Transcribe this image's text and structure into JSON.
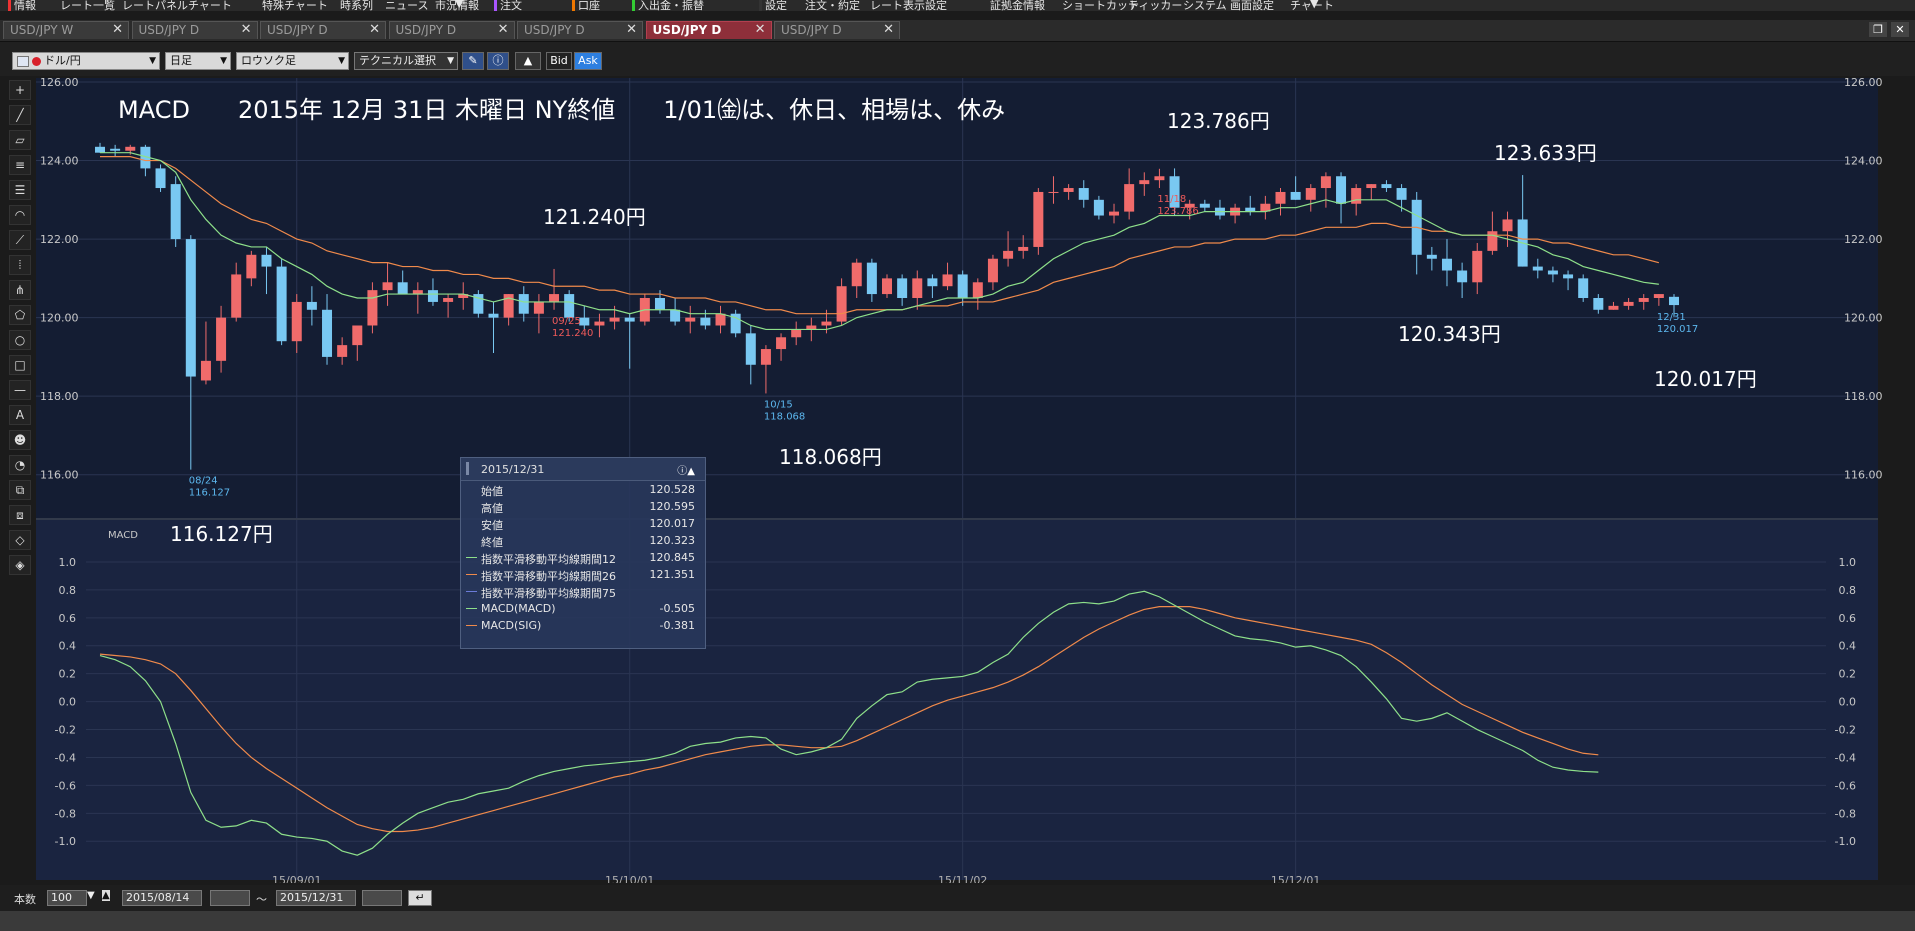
{
  "menu": [
    "情報",
    "レート一覧",
    "レートパネル",
    "チャート",
    "特殊チャート",
    "時系列",
    "ニュース",
    "市況情報",
    "▼",
    "注文",
    "口座",
    "入出金・振替",
    "設定",
    "注文・約定",
    "レート表示設定",
    "証拠金情報",
    "ショートカット",
    "ティッカー",
    "システム",
    "画面設定",
    "チャート",
    "▼"
  ],
  "tabs": [
    {
      "label": "USD/JPY W"
    },
    {
      "label": "USD/JPY D"
    },
    {
      "label": "USD/JPY D"
    },
    {
      "label": "USD/JPY D"
    },
    {
      "label": "USD/JPY D"
    },
    {
      "label": "USD/JPY D",
      "active": true
    },
    {
      "label": "USD/JPY D"
    }
  ],
  "toolbar": {
    "pair": "ドル/円",
    "period": "日足",
    "chart_type": "ロウソク足",
    "technical": "テクニカル選択",
    "bid": "Bid",
    "ask": "Ask"
  },
  "tools": [
    "crosshair-icon",
    "line-icon",
    "ruler-icon",
    "lines-icon",
    "channel-icon",
    "arc-icon",
    "fan-icon",
    "grid-icon",
    "pitchfork-icon",
    "pentagon-icon",
    "circle-icon",
    "rectangle-icon",
    "hline-icon",
    "text-icon",
    "smiley-icon",
    "paint-icon",
    "copy-icon",
    "layers-icon",
    "eraser-icon",
    "eraser-all-icon"
  ],
  "tool_text": {
    "text": "A",
    "smiley": "☻"
  },
  "annotation": {
    "headline": "MACD　　2015年 12月 31日 木曜日 NY終値　　1/01㈮は、休日、相場は、休み",
    "p1": "121.240円",
    "p2": "123.786円",
    "p3": "123.633円",
    "p4": "120.343円",
    "p5": "120.017円",
    "p6": "118.068円",
    "p7": "116.127円"
  },
  "chart_data": {
    "type": "candlestick",
    "price_ticks": [
      "126.00",
      "124.00",
      "122.00",
      "120.00",
      "118.00",
      "116.00"
    ],
    "macd_ticks": [
      "1.0",
      "0.8",
      "0.6",
      "0.4",
      "0.2",
      "0.0",
      "-0.2",
      "-0.4",
      "-0.6",
      "-0.8",
      "-1.0"
    ],
    "x_ticks": [
      "15/09/01",
      "15/10/01",
      "15/11/02",
      "15/12/01"
    ],
    "macd_label": "MACD",
    "ylim": [
      115.0,
      126.0
    ],
    "macd_ylim": [
      -1.12,
      1.1
    ],
    "marks": [
      {
        "date": "08/24",
        "value": "116.127",
        "color": "#5cb7ee"
      },
      {
        "date": "09/25",
        "value": "121.240",
        "color": "#ef5a5a"
      },
      {
        "date": "10/15",
        "value": "118.068",
        "color": "#5cb7ee"
      },
      {
        "date": "11/18",
        "value": "123.786",
        "color": "#ef5a5a"
      },
      {
        "date": "12/31",
        "value": "120.017",
        "color": "#5cb7ee"
      }
    ],
    "candles": [
      [
        124.35,
        124.45,
        124.2,
        124.2
      ],
      [
        124.3,
        124.4,
        124.1,
        124.25
      ],
      [
        124.25,
        124.4,
        124.15,
        124.35
      ],
      [
        124.35,
        124.4,
        123.6,
        123.8
      ],
      [
        123.8,
        123.9,
        123.2,
        123.3
      ],
      [
        123.4,
        123.6,
        121.8,
        122.0
      ],
      [
        122.0,
        122.1,
        116.13,
        118.5
      ],
      [
        118.4,
        119.9,
        118.3,
        118.9
      ],
      [
        118.9,
        120.3,
        118.6,
        120.0
      ],
      [
        120.0,
        121.4,
        119.9,
        121.1
      ],
      [
        121.0,
        121.7,
        120.8,
        121.6
      ],
      [
        121.6,
        121.8,
        120.6,
        121.3
      ],
      [
        121.3,
        121.5,
        119.3,
        119.4
      ],
      [
        119.4,
        120.6,
        119.1,
        120.4
      ],
      [
        120.4,
        120.8,
        119.8,
        120.2
      ],
      [
        120.2,
        120.6,
        118.8,
        119.0
      ],
      [
        119.0,
        119.5,
        118.8,
        119.3
      ],
      [
        119.3,
        119.8,
        118.9,
        119.8
      ],
      [
        119.8,
        120.9,
        119.6,
        120.7
      ],
      [
        120.7,
        121.4,
        120.3,
        120.9
      ],
      [
        120.9,
        121.2,
        120.6,
        120.6
      ],
      [
        120.6,
        120.9,
        120.1,
        120.7
      ],
      [
        120.7,
        121.0,
        120.3,
        120.4
      ],
      [
        120.4,
        120.6,
        120.0,
        120.5
      ],
      [
        120.5,
        120.9,
        120.2,
        120.6
      ],
      [
        120.6,
        120.7,
        120.0,
        120.1
      ],
      [
        120.1,
        120.4,
        119.1,
        120.0
      ],
      [
        120.0,
        120.6,
        119.8,
        120.6
      ],
      [
        120.6,
        120.8,
        119.9,
        120.1
      ],
      [
        120.1,
        120.6,
        119.6,
        120.4
      ],
      [
        120.4,
        121.24,
        120.2,
        120.6
      ],
      [
        120.6,
        120.7,
        119.9,
        120.0
      ],
      [
        120.0,
        120.3,
        119.7,
        119.8
      ],
      [
        119.8,
        120.1,
        119.5,
        119.9
      ],
      [
        119.9,
        120.3,
        119.7,
        120.0
      ],
      [
        120.0,
        120.1,
        118.7,
        119.9
      ],
      [
        119.9,
        120.6,
        119.8,
        120.5
      ],
      [
        120.5,
        120.7,
        120.1,
        120.2
      ],
      [
        120.2,
        120.5,
        119.8,
        119.9
      ],
      [
        119.9,
        120.3,
        119.6,
        120.0
      ],
      [
        120.0,
        120.2,
        119.7,
        119.8
      ],
      [
        119.8,
        120.3,
        119.6,
        120.1
      ],
      [
        120.1,
        120.2,
        119.5,
        119.6
      ],
      [
        119.6,
        119.8,
        118.3,
        118.8
      ],
      [
        118.8,
        119.3,
        118.07,
        119.2
      ],
      [
        119.2,
        119.6,
        118.9,
        119.5
      ],
      [
        119.5,
        119.9,
        119.3,
        119.7
      ],
      [
        119.7,
        120.0,
        119.4,
        119.8
      ],
      [
        119.8,
        120.2,
        119.6,
        119.9
      ],
      [
        119.9,
        121.0,
        119.8,
        120.8
      ],
      [
        120.8,
        121.5,
        120.5,
        121.4
      ],
      [
        121.4,
        121.5,
        120.4,
        120.6
      ],
      [
        120.6,
        121.1,
        120.5,
        121.0
      ],
      [
        121.0,
        121.1,
        120.3,
        120.5
      ],
      [
        120.5,
        121.2,
        120.2,
        121.0
      ],
      [
        121.0,
        121.1,
        120.5,
        120.8
      ],
      [
        120.8,
        121.4,
        120.7,
        121.1
      ],
      [
        121.1,
        121.2,
        120.3,
        120.5
      ],
      [
        120.5,
        121.0,
        120.2,
        120.9
      ],
      [
        120.9,
        121.6,
        120.7,
        121.5
      ],
      [
        121.5,
        122.2,
        121.3,
        121.7
      ],
      [
        121.7,
        122.1,
        121.5,
        121.8
      ],
      [
        121.8,
        123.3,
        121.6,
        123.2
      ],
      [
        123.2,
        123.6,
        122.9,
        123.2
      ],
      [
        123.2,
        123.4,
        123.0,
        123.3
      ],
      [
        123.3,
        123.5,
        122.8,
        123.0
      ],
      [
        123.0,
        123.1,
        122.5,
        122.6
      ],
      [
        122.6,
        122.9,
        122.4,
        122.7
      ],
      [
        122.7,
        123.8,
        122.5,
        123.4
      ],
      [
        123.4,
        123.7,
        123.1,
        123.5
      ],
      [
        123.5,
        123.79,
        123.3,
        123.6
      ],
      [
        123.6,
        123.8,
        122.6,
        122.8
      ],
      [
        122.8,
        123.0,
        122.5,
        122.9
      ],
      [
        122.9,
        123.0,
        122.7,
        122.8
      ],
      [
        122.8,
        123.0,
        122.5,
        122.6
      ],
      [
        122.6,
        122.9,
        122.4,
        122.8
      ],
      [
        122.8,
        123.1,
        122.6,
        122.7
      ],
      [
        122.7,
        123.1,
        122.5,
        122.9
      ],
      [
        122.9,
        123.3,
        122.6,
        123.2
      ],
      [
        123.2,
        123.6,
        123.0,
        123.0
      ],
      [
        123.0,
        123.4,
        122.7,
        123.3
      ],
      [
        123.3,
        123.7,
        122.8,
        123.6
      ],
      [
        123.6,
        123.7,
        122.4,
        122.9
      ],
      [
        122.9,
        123.4,
        122.6,
        123.3
      ],
      [
        123.3,
        123.4,
        123.0,
        123.4
      ],
      [
        123.4,
        123.5,
        123.2,
        123.3
      ],
      [
        123.3,
        123.4,
        122.7,
        123.0
      ],
      [
        123.0,
        123.2,
        121.1,
        121.6
      ],
      [
        121.6,
        121.8,
        121.2,
        121.5
      ],
      [
        121.5,
        122.0,
        120.8,
        121.2
      ],
      [
        121.2,
        121.4,
        120.5,
        120.9
      ],
      [
        120.9,
        121.9,
        120.6,
        121.7
      ],
      [
        121.7,
        122.7,
        121.6,
        122.2
      ],
      [
        122.2,
        122.7,
        121.8,
        122.5
      ],
      [
        122.5,
        123.63,
        121.3,
        121.3
      ],
      [
        121.3,
        121.5,
        121.0,
        121.2
      ],
      [
        121.2,
        121.3,
        120.9,
        121.1
      ],
      [
        121.1,
        121.2,
        120.7,
        121.0
      ],
      [
        121.0,
        121.1,
        120.4,
        120.5
      ],
      [
        120.5,
        120.6,
        120.1,
        120.2
      ],
      [
        120.2,
        120.4,
        120.2,
        120.3
      ],
      [
        120.3,
        120.5,
        120.2,
        120.4
      ],
      [
        120.4,
        120.6,
        120.2,
        120.5
      ],
      [
        120.5,
        120.6,
        120.3,
        120.6
      ],
      [
        120.53,
        120.6,
        120.02,
        120.32
      ]
    ],
    "ema12": [
      124.2,
      124.2,
      124.2,
      124.1,
      124.0,
      123.7,
      123.0,
      122.5,
      122.1,
      121.9,
      121.8,
      121.8,
      121.5,
      121.3,
      121.1,
      120.8,
      120.6,
      120.5,
      120.5,
      120.6,
      120.6,
      120.6,
      120.6,
      120.6,
      120.6,
      120.5,
      120.4,
      120.5,
      120.4,
      120.4,
      120.4,
      120.4,
      120.3,
      120.2,
      120.2,
      120.1,
      120.2,
      120.2,
      120.2,
      120.1,
      120.1,
      120.1,
      120.0,
      119.8,
      119.7,
      119.7,
      119.7,
      119.7,
      119.7,
      119.8,
      120.0,
      120.1,
      120.2,
      120.2,
      120.3,
      120.4,
      120.5,
      120.5,
      120.5,
      120.6,
      120.8,
      120.9,
      121.2,
      121.5,
      121.7,
      121.9,
      122.0,
      122.1,
      122.3,
      122.4,
      122.6,
      122.6,
      122.6,
      122.7,
      122.7,
      122.7,
      122.7,
      122.7,
      122.8,
      122.8,
      122.9,
      123.0,
      122.9,
      123.0,
      123.0,
      123.0,
      122.8,
      122.6,
      122.4,
      122.2,
      122.1,
      122.1,
      122.1,
      122.0,
      121.9,
      121.8,
      121.6,
      121.5,
      121.3,
      121.2,
      121.1,
      121.0,
      120.9,
      120.85
    ],
    "ema26": [
      124.1,
      124.1,
      124.1,
      124.0,
      124.0,
      123.8,
      123.5,
      123.2,
      122.9,
      122.7,
      122.5,
      122.4,
      122.2,
      122.0,
      121.9,
      121.7,
      121.6,
      121.5,
      121.4,
      121.4,
      121.3,
      121.3,
      121.2,
      121.2,
      121.1,
      121.1,
      121.0,
      121.0,
      120.9,
      120.9,
      120.8,
      120.8,
      120.8,
      120.7,
      120.7,
      120.6,
      120.6,
      120.6,
      120.5,
      120.5,
      120.5,
      120.4,
      120.4,
      120.3,
      120.2,
      120.2,
      120.1,
      120.1,
      120.1,
      120.1,
      120.2,
      120.2,
      120.2,
      120.2,
      120.3,
      120.3,
      120.3,
      120.4,
      120.4,
      120.4,
      120.5,
      120.6,
      120.7,
      120.9,
      121.0,
      121.1,
      121.2,
      121.3,
      121.5,
      121.6,
      121.7,
      121.8,
      121.8,
      121.9,
      121.9,
      122.0,
      122.0,
      122.0,
      122.1,
      122.1,
      122.2,
      122.3,
      122.3,
      122.3,
      122.4,
      122.4,
      122.3,
      122.3,
      122.2,
      122.2,
      122.1,
      122.1,
      122.1,
      122.1,
      122.0,
      122.0,
      121.9,
      121.9,
      121.8,
      121.7,
      121.6,
      121.6,
      121.5,
      121.4
    ],
    "macd": [
      0.33,
      0.3,
      0.25,
      0.15,
      0.0,
      -0.3,
      -0.65,
      -0.85,
      -0.9,
      -0.89,
      -0.85,
      -0.87,
      -0.95,
      -0.97,
      -0.98,
      -1.0,
      -1.07,
      -1.1,
      -1.05,
      -0.95,
      -0.87,
      -0.8,
      -0.76,
      -0.72,
      -0.7,
      -0.66,
      -0.64,
      -0.62,
      -0.57,
      -0.53,
      -0.5,
      -0.48,
      -0.46,
      -0.45,
      -0.44,
      -0.43,
      -0.42,
      -0.4,
      -0.37,
      -0.32,
      -0.3,
      -0.29,
      -0.26,
      -0.25,
      -0.26,
      -0.34,
      -0.38,
      -0.36,
      -0.33,
      -0.27,
      -0.12,
      -0.03,
      0.05,
      0.07,
      0.14,
      0.16,
      0.17,
      0.18,
      0.21,
      0.28,
      0.34,
      0.46,
      0.56,
      0.64,
      0.7,
      0.71,
      0.7,
      0.72,
      0.77,
      0.79,
      0.75,
      0.69,
      0.63,
      0.57,
      0.52,
      0.47,
      0.45,
      0.44,
      0.42,
      0.39,
      0.4,
      0.37,
      0.33,
      0.25,
      0.14,
      0.02,
      -0.12,
      -0.14,
      -0.12,
      -0.08,
      -0.14,
      -0.2,
      -0.25,
      -0.3,
      -0.35,
      -0.42,
      -0.47,
      -0.49,
      -0.5,
      -0.505
    ],
    "sig": [
      0.34,
      0.33,
      0.32,
      0.3,
      0.27,
      0.2,
      0.08,
      -0.05,
      -0.18,
      -0.3,
      -0.4,
      -0.48,
      -0.55,
      -0.62,
      -0.69,
      -0.76,
      -0.82,
      -0.88,
      -0.91,
      -0.93,
      -0.93,
      -0.92,
      -0.9,
      -0.87,
      -0.84,
      -0.81,
      -0.78,
      -0.75,
      -0.72,
      -0.69,
      -0.66,
      -0.63,
      -0.6,
      -0.57,
      -0.54,
      -0.52,
      -0.49,
      -0.47,
      -0.44,
      -0.41,
      -0.38,
      -0.36,
      -0.34,
      -0.32,
      -0.31,
      -0.31,
      -0.32,
      -0.33,
      -0.33,
      -0.32,
      -0.28,
      -0.23,
      -0.18,
      -0.13,
      -0.08,
      -0.03,
      0.01,
      0.04,
      0.07,
      0.1,
      0.14,
      0.19,
      0.25,
      0.32,
      0.39,
      0.46,
      0.52,
      0.57,
      0.62,
      0.66,
      0.68,
      0.68,
      0.68,
      0.66,
      0.63,
      0.6,
      0.58,
      0.56,
      0.54,
      0.52,
      0.5,
      0.48,
      0.46,
      0.44,
      0.41,
      0.35,
      0.28,
      0.2,
      0.12,
      0.05,
      -0.02,
      -0.07,
      -0.12,
      -0.17,
      -0.22,
      -0.26,
      -0.3,
      -0.34,
      -0.37,
      -0.381
    ]
  },
  "info_panel": {
    "date": "2015/12/31",
    "rows": [
      {
        "label": "始値",
        "value": "120.528",
        "color": ""
      },
      {
        "label": "高値",
        "value": "120.595",
        "color": ""
      },
      {
        "label": "安値",
        "value": "120.017",
        "color": ""
      },
      {
        "label": "終値",
        "value": "120.323",
        "color": ""
      },
      {
        "label": "指数平滑移動平均線期間12",
        "value": "120.845",
        "color": "#8ee08a"
      },
      {
        "label": "指数平滑移動平均線期間26",
        "value": "121.351",
        "color": "#f08a4b"
      },
      {
        "label": "指数平滑移動平均線期間75",
        "value": "",
        "color": "#6b7bd8"
      },
      {
        "label": "MACD(MACD)",
        "value": "-0.505",
        "color": "#8ee08a"
      },
      {
        "label": "MACD(SIG)",
        "value": "-0.381",
        "color": "#f08a4b"
      }
    ]
  },
  "status": {
    "count_label": "本数",
    "count": "100",
    "start_date": "2015/08/14",
    "tilde": "～",
    "end_date": "2015/12/31"
  },
  "colors": {
    "up": "#f06b6b",
    "down": "#79c8f2",
    "ema12": "#8ee08a",
    "ema26": "#f08a4b"
  }
}
